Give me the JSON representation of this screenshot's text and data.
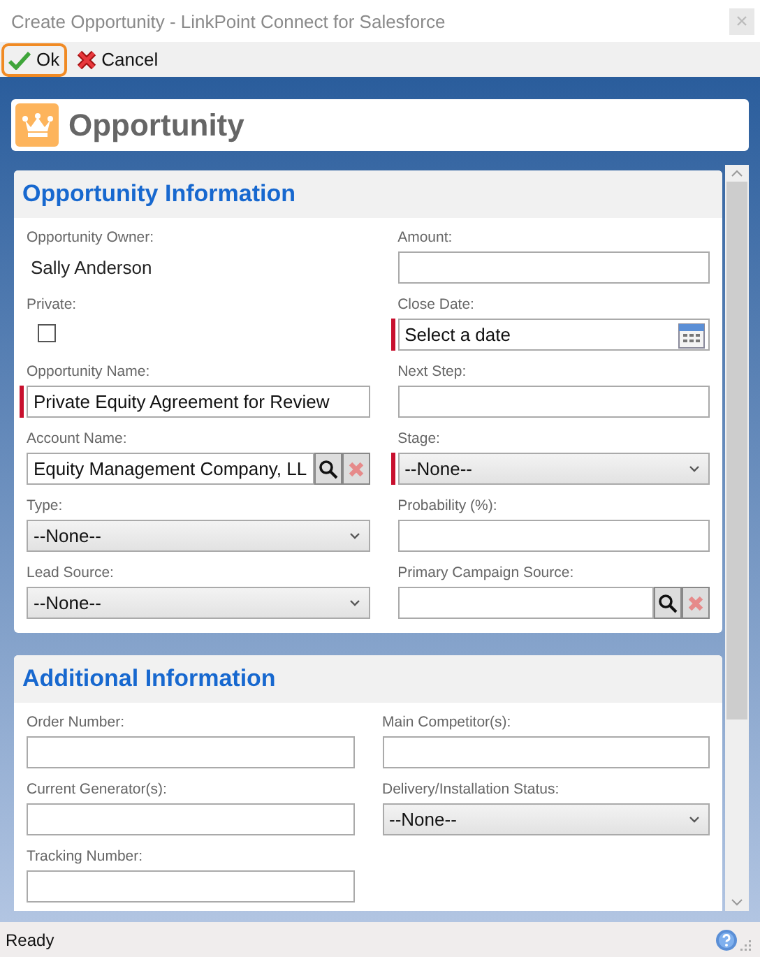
{
  "window": {
    "title": "Create Opportunity - LinkPoint Connect for Salesforce"
  },
  "toolbar": [
    {
      "label": "Ok",
      "kind": "ok",
      "focused": true
    },
    {
      "label": "Cancel",
      "kind": "cancel",
      "focused": false
    }
  ],
  "header": {
    "title": "Opportunity"
  },
  "sections": [
    {
      "title": "Opportunity Information",
      "left": [
        {
          "label": "Opportunity Owner:",
          "kind": "readonly",
          "value": "Sally Anderson",
          "required": false
        },
        {
          "label": "Private:",
          "kind": "checkbox",
          "checked": false,
          "required": false
        },
        {
          "label": "Opportunity Name:",
          "kind": "text",
          "value": "Private Equity Agreement for Review",
          "required": true
        },
        {
          "label": "Account Name:",
          "kind": "lookup",
          "value": "Equity Management Company, LL",
          "required": false
        },
        {
          "label": "Type:",
          "kind": "select",
          "value": "--None--",
          "required": false
        },
        {
          "label": "Lead Source:",
          "kind": "select",
          "value": "--None--",
          "required": false
        }
      ],
      "right": [
        {
          "label": "Amount:",
          "kind": "text",
          "required": false
        },
        {
          "label": "Close Date:",
          "kind": "date",
          "placeholder": "Select a date",
          "required": true
        },
        {
          "label": "Next Step:",
          "kind": "text",
          "required": false
        },
        {
          "label": "Stage:",
          "kind": "select",
          "value": "--None--",
          "required": true
        },
        {
          "label": "Probability (%):",
          "kind": "text",
          "required": false
        },
        {
          "label": "Primary Campaign Source:",
          "kind": "lookup",
          "required": false
        }
      ]
    },
    {
      "title": "Additional Information",
      "left": [
        {
          "label": "Order Number:",
          "kind": "text",
          "required": false
        },
        {
          "label": "Current Generator(s):",
          "kind": "text",
          "required": false
        },
        {
          "label": "Tracking Number:",
          "kind": "text",
          "required": false
        }
      ],
      "right": [
        {
          "label": "Main Competitor(s):",
          "kind": "text",
          "required": false
        },
        {
          "label": "Delivery/Installation Status:",
          "kind": "select",
          "value": "--None--",
          "required": false
        }
      ]
    }
  ],
  "status_bar": {
    "text": "Ready"
  }
}
